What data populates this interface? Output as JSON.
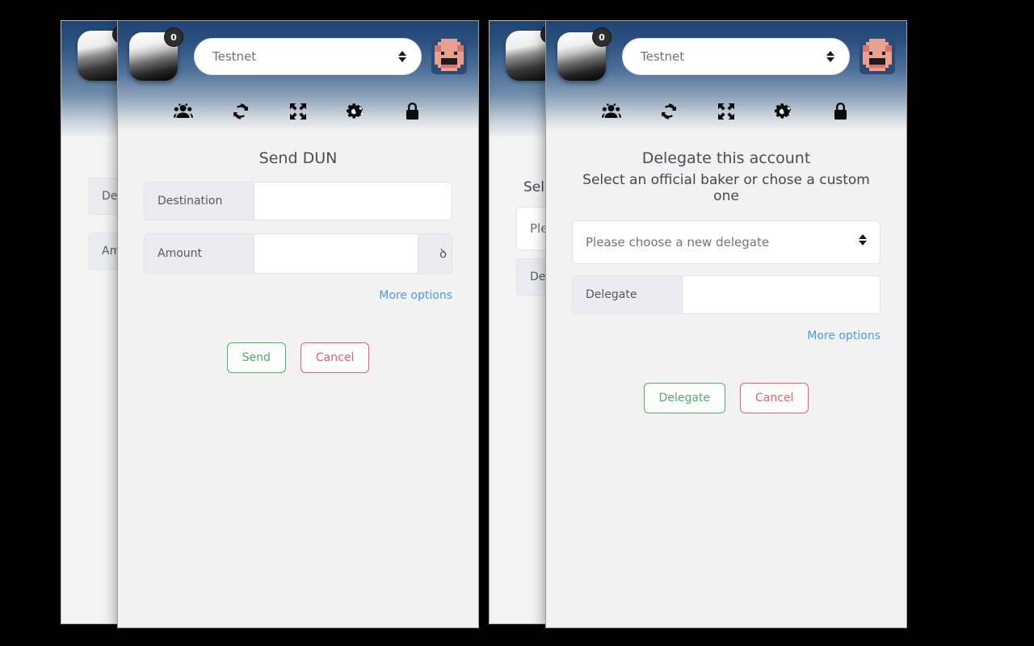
{
  "app": {
    "badge_count": "0",
    "network": "Testnet",
    "accent_link": "#4f9ae8",
    "accent_success": "#4fb564",
    "accent_danger": "#e4606d",
    "header_gradient_top": "#1f4473",
    "header_gradient_bottom": "#f0f1f2"
  },
  "toolbar": {
    "items": [
      {
        "icon": "users-icon",
        "name": "accounts"
      },
      {
        "icon": "refresh-icon",
        "name": "refresh"
      },
      {
        "icon": "expand-icon",
        "name": "expand"
      },
      {
        "icon": "gears-icon",
        "name": "settings"
      },
      {
        "icon": "lock-icon",
        "name": "lock"
      }
    ]
  },
  "send_window": {
    "title": "Send DUN",
    "fields": [
      {
        "label": "Destination",
        "value": "",
        "placeholder": "",
        "unit": ""
      },
      {
        "label": "Amount",
        "value": "",
        "placeholder": "",
        "unit": "ꝺ"
      }
    ],
    "more_options": "More options",
    "buttons": {
      "confirm": "Send",
      "cancel": "Cancel"
    }
  },
  "delegate_window": {
    "title": "Delegate this account",
    "subtitle": "Select an official baker or chose a custom one",
    "select": {
      "value": "Please choose a new delegate",
      "options": [
        "Please choose a new delegate"
      ]
    },
    "fields": [
      {
        "label": "Delegate",
        "value": "",
        "placeholder": ""
      }
    ],
    "more_options": "More options",
    "buttons": {
      "confirm": "Delegate",
      "cancel": "Cancel"
    }
  },
  "background_send_window": {
    "fields": [
      {
        "label": "Destination"
      },
      {
        "label": "Amount"
      }
    ]
  },
  "background_delegate_window": {
    "subtitle": "Select an official baker or chose a custom one",
    "select": {
      "value": "Please choose a new delegate"
    },
    "fields": [
      {
        "label": "Delegate"
      }
    ]
  }
}
